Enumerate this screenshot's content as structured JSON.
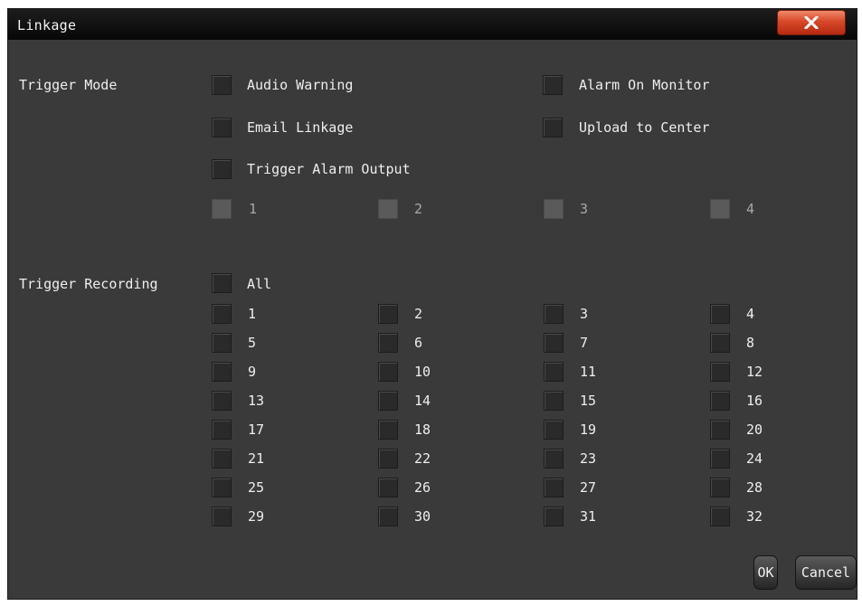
{
  "window": {
    "title": "Linkage",
    "close_icon": "close-x-icon"
  },
  "trigger_mode": {
    "label": "Trigger Mode",
    "options": [
      {
        "label": "Audio Warning",
        "checked": false
      },
      {
        "label": "Alarm On Monitor",
        "checked": false
      },
      {
        "label": "Email Linkage",
        "checked": false
      },
      {
        "label": "Upload to Center",
        "checked": false
      },
      {
        "label": "Trigger Alarm Output",
        "checked": false
      }
    ],
    "alarm_outputs": [
      {
        "label": "1",
        "enabled": false
      },
      {
        "label": "2",
        "enabled": false
      },
      {
        "label": "3",
        "enabled": false
      },
      {
        "label": "4",
        "enabled": false
      }
    ]
  },
  "trigger_recording": {
    "label": "Trigger Recording",
    "all_label": "All",
    "channels": [
      "1",
      "2",
      "3",
      "4",
      "5",
      "6",
      "7",
      "8",
      "9",
      "10",
      "11",
      "12",
      "13",
      "14",
      "15",
      "16",
      "17",
      "18",
      "19",
      "20",
      "21",
      "22",
      "23",
      "24",
      "25",
      "26",
      "27",
      "28",
      "29",
      "30",
      "31",
      "32"
    ]
  },
  "buttons": {
    "ok": "OK",
    "cancel": "Cancel"
  },
  "colors": {
    "panel": "#3a3a3a",
    "titlebar": "#0a0a0a",
    "close_button": "#d8482a",
    "text": "#eeeeee"
  }
}
